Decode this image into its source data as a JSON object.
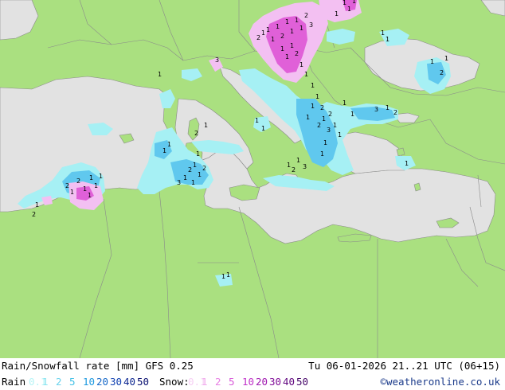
{
  "map": {
    "colors": {
      "land": "#aae080",
      "sea": "#e2e2e2",
      "border": "#8a8a8a",
      "rain_light": "#a6f0f4",
      "rain_medium": "#60c8ee",
      "snow_light": "#f3c0f2",
      "snow_medium": "#e060d8"
    },
    "marker_values": [
      "1",
      "2",
      "3"
    ]
  },
  "footer": {
    "title": "Rain/Snowfall rate [mm] GFS 0.25",
    "valid_time": "Tu 06-01-2026 21..21 UTC (06+15)",
    "rain_label": "Rain",
    "snow_label": "Snow:",
    "copyright": "©weatheronline.co.uk",
    "rain_scale": [
      {
        "value": "0.1",
        "color": "#b6f4f6"
      },
      {
        "value": "1",
        "color": "#88e2f0"
      },
      {
        "value": "2",
        "color": "#6ad2ec"
      },
      {
        "value": "5",
        "color": "#40c0e6"
      },
      {
        "value": "10",
        "color": "#1e9ae0"
      },
      {
        "value": "20",
        "color": "#1668c8"
      },
      {
        "value": "30",
        "color": "#1040b0"
      },
      {
        "value": "40",
        "color": "#0c2690"
      },
      {
        "value": "50",
        "color": "#080e70"
      }
    ],
    "snow_scale": [
      {
        "value": "0.1",
        "color": "#f6d0f4"
      },
      {
        "value": "1",
        "color": "#f0a8ec"
      },
      {
        "value": "2",
        "color": "#e880e4"
      },
      {
        "value": "5",
        "color": "#d858d8"
      },
      {
        "value": "10",
        "color": "#c030c8"
      },
      {
        "value": "20",
        "color": "#a018b0"
      },
      {
        "value": "30",
        "color": "#800c98"
      },
      {
        "value": "40",
        "color": "#620880"
      },
      {
        "value": "50",
        "color": "#440468"
      }
    ]
  }
}
